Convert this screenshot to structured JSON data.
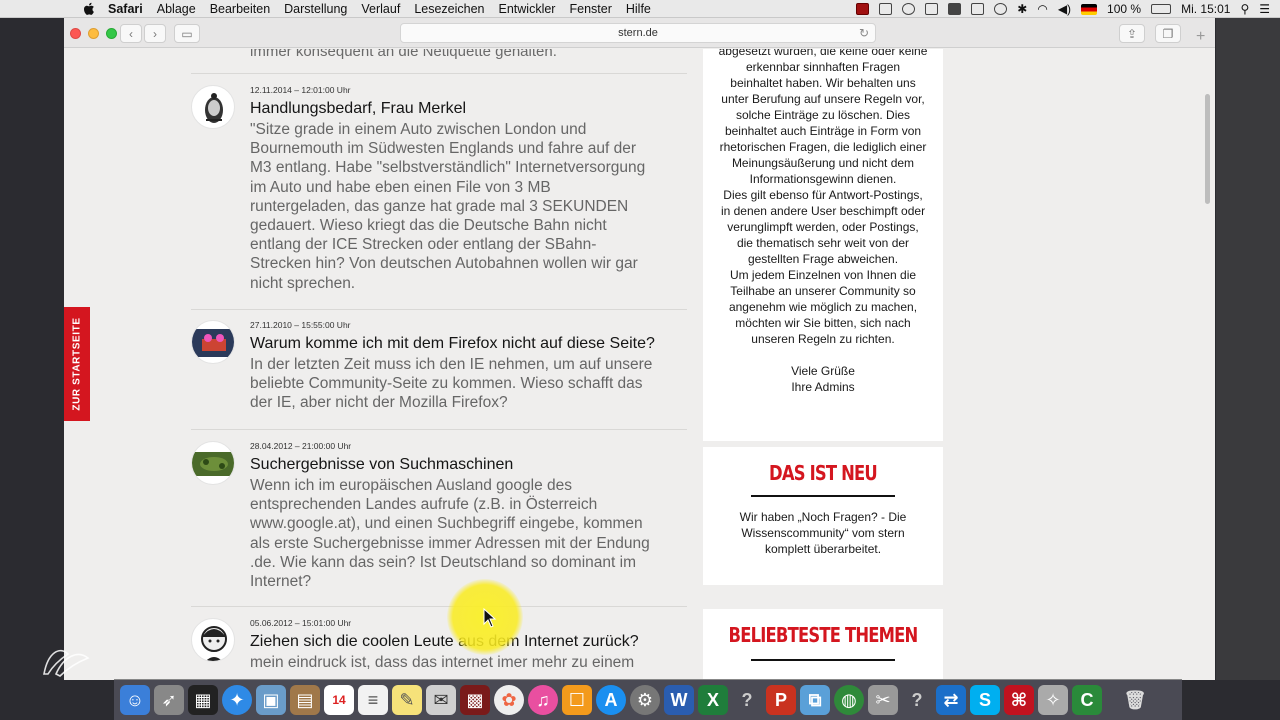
{
  "menubar": {
    "app": "Safari",
    "menus": [
      "Ablage",
      "Bearbeiten",
      "Darstellung",
      "Verlauf",
      "Lesezeichen",
      "Entwickler",
      "Fenster",
      "Hilfe"
    ],
    "battery": "100 %",
    "clock": "Mi. 15:01"
  },
  "browser": {
    "url": "stern.de"
  },
  "page": {
    "side_tab": "ZUR STARTSEITE",
    "previous_text": "immer konsequent an die Netiquette gehalten.",
    "entries": [
      {
        "date": "12.11.2014 – 12:01:00 Uhr",
        "title": "Handlungsbedarf, Frau Merkel",
        "lines": [
          "\"Sitze grade in einem Auto zwischen London und",
          "Bournemouth im Südwesten Englands und fahre auf der",
          "M3 entlang. Habe \"selbstverständlich\" Internetversorgung",
          "im Auto und habe eben einen File von 3 MB",
          "runtergeladen, das ganze hat grade mal 3 SEKUNDEN",
          "gedauert. Wieso kriegt das die Deutsche Bahn nicht",
          "entlang der ICE Strecken oder entlang der SBahn-",
          "Strecken hin? Von deutschen Autobahnen wollen wir gar",
          "nicht sprechen."
        ]
      },
      {
        "date": "27.11.2010 – 15:55:00 Uhr",
        "title": "Warum komme ich mit dem Firefox nicht auf diese Seite?",
        "lines": [
          "In der letzten Zeit muss ich den IE nehmen, um auf unsere",
          "beliebte Community-Seite zu kommen. Wieso schafft das",
          "der IE, aber nicht der Mozilla Firefox?"
        ]
      },
      {
        "date": "28.04.2012 – 21:00:00 Uhr",
        "title": "Suchergebnisse von Suchmaschinen",
        "lines": [
          "Wenn ich im europäischen Ausland google des",
          "entsprechenden Landes aufrufe (z.B. in Österreich",
          "www.google.at), und einen Suchbegriff eingebe, kommen",
          "als erste Suchergebnisse immer Adressen mit der Endung",
          ".de. Wie kann das sein? Ist Deutschland so dominant im",
          "Internet?"
        ]
      },
      {
        "date": "05.06.2012 – 15:01:00 Uhr",
        "title": "Ziehen sich die coolen Leute aus dem Internet zurück?",
        "lines": [
          "mein eindruck ist, dass das internet imer mehr zu einem"
        ]
      }
    ],
    "rules_lines": [
      "abgesetzt wurden, die keine oder keine",
      "erkennbar sinnhaften Fragen",
      "beinhaltet haben. Wir behalten uns",
      "unter Berufung auf unsere Regeln vor,",
      "solche Einträge zu löschen. Dies",
      "beinhaltet auch Einträge in Form von",
      "rhetorischen Fragen, die lediglich einer",
      "Meinungsäußerung und nicht dem",
      "Informationsgewinn dienen.",
      "Dies gilt ebenso für Antwort-Postings,",
      "in denen andere User beschimpft oder",
      "verunglimpft werden, oder Postings,",
      "die thematisch sehr weit von der",
      "gestellten Frage abweichen.",
      "Um jedem Einzelnen von Ihnen die",
      "Teilhabe an unserer Community so",
      "angenehm wie möglich zu machen,",
      "möchten wir Sie bitten, sich nach",
      "unseren Regeln zu richten.",
      "",
      "Viele Grüße",
      "Ihre Admins"
    ],
    "neu": {
      "heading": "DAS IST NEU",
      "lines": [
        "Wir haben „Noch Fragen? - Die",
        "Wissenscommunity“ vom stern",
        "komplett überarbeitet."
      ]
    },
    "themen": {
      "heading": "BELIEBTESTE THEMEN"
    }
  },
  "dock": {
    "calendar_day": "14",
    "apps": [
      "finder-icon",
      "launchpad-icon",
      "mission-control-icon",
      "safari-icon",
      "preview-icon",
      "notes-icon",
      "calendar-icon",
      "stickies-icon",
      "textedit-icon",
      "mail-icon",
      "photo-booth-icon",
      "photos-icon",
      "itunes-icon",
      "ibooks-icon",
      "app-store-icon",
      "system-preferences-icon",
      "word-icon",
      "excel-icon",
      "help-icon",
      "powerpoint-icon",
      "shared-icon",
      "globe-icon",
      "utility-icon",
      "help2-icon",
      "teamviewer-icon",
      "skype-icon",
      "acrobat-icon",
      "utility2-icon",
      "camtasia-icon",
      "trash-icon"
    ]
  },
  "colors": {
    "accent_red": "#d4161f",
    "page_bg": "#efeeed"
  }
}
